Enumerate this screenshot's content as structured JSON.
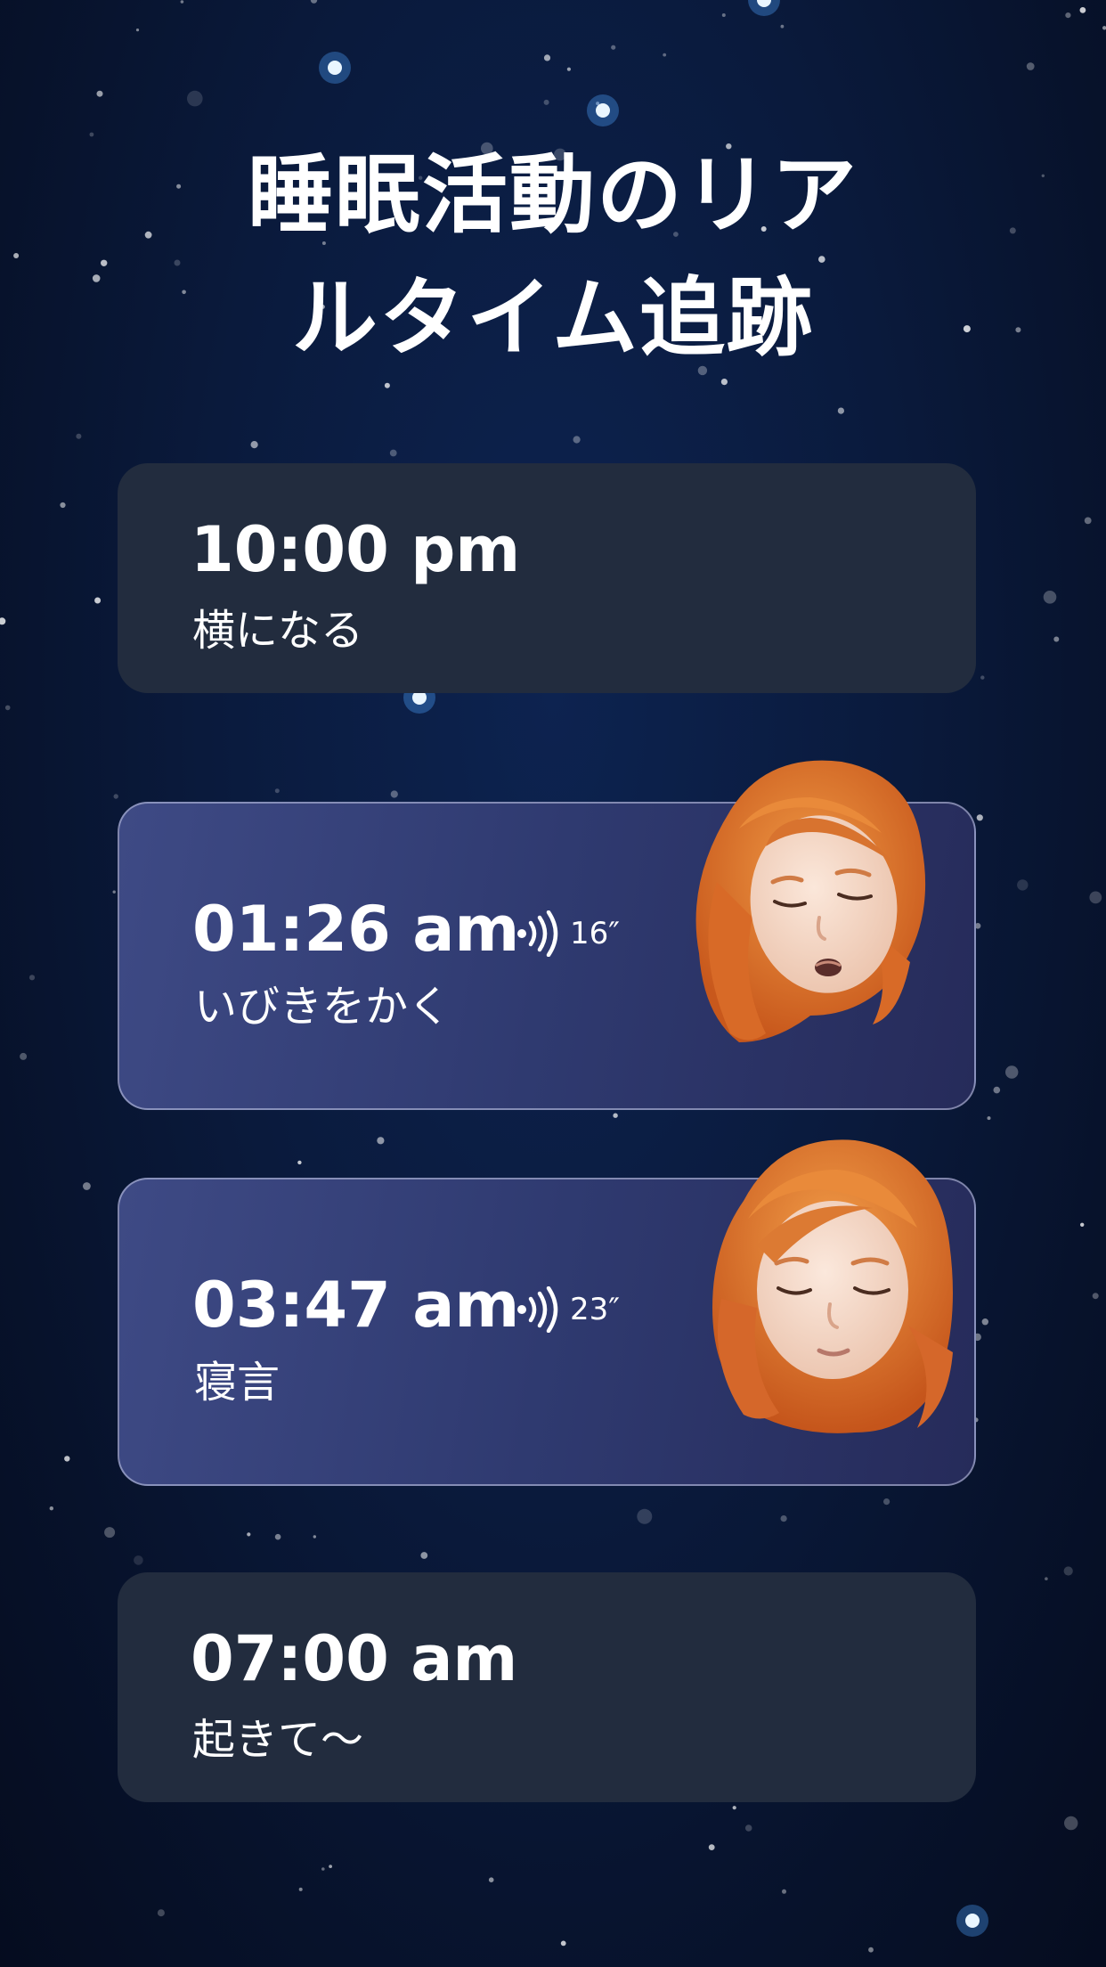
{
  "title": {
    "line1": "睡眠活動のリア",
    "line2": "ルタイム追跡"
  },
  "events": [
    {
      "time": "10:00 pm",
      "label": "横になる"
    },
    {
      "time": "01:26 am",
      "label": "いびきをかく",
      "sound_duration": "16″",
      "icon": "sound-wave-icon",
      "avatar": "sleeping-avatar-snoring"
    },
    {
      "time": "03:47 am",
      "label": "寝言",
      "sound_duration": "23″",
      "icon": "sound-wave-icon",
      "avatar": "sleeping-avatar-talking"
    },
    {
      "time": "07:00 am",
      "label": "起きて～"
    }
  ],
  "colors": {
    "background": "#0a1a3c",
    "card_plain": "#222c3e",
    "card_event": "#343f78",
    "hair": "#e07a2c",
    "skin": "#f6dccb"
  }
}
